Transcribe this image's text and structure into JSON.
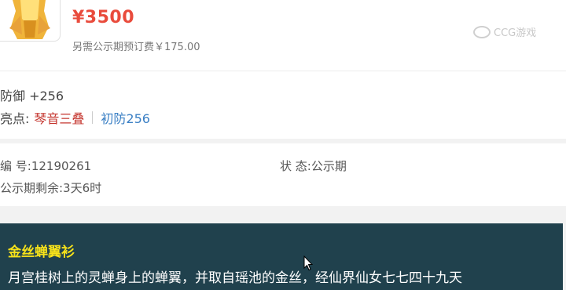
{
  "item": {
    "price": "¥3500",
    "deposit_note": "另需公示期预订费￥175.00",
    "watermark": "CCG游戏"
  },
  "attributes": {
    "defense": "防御 +256",
    "highlights_label": "亮点:",
    "highlights": [
      "琴音三叠",
      "初防256"
    ]
  },
  "info": {
    "serial": "编 号:12190261",
    "status": "状 态:公示期",
    "remaining": "公示期剩余:3天6时"
  },
  "description": {
    "title": "金丝蝉翼衫",
    "text": "月宫桂树上的灵蝉身上的蝉翼，并取自瑶池的金丝，经仙界仙女七七四十九天"
  },
  "colors": {
    "price": "#e94b3c",
    "highlight_red": "#c4342d",
    "highlight_blue": "#3a7fc4",
    "banner_bg": "#20414d",
    "banner_title": "#f7e21a"
  }
}
